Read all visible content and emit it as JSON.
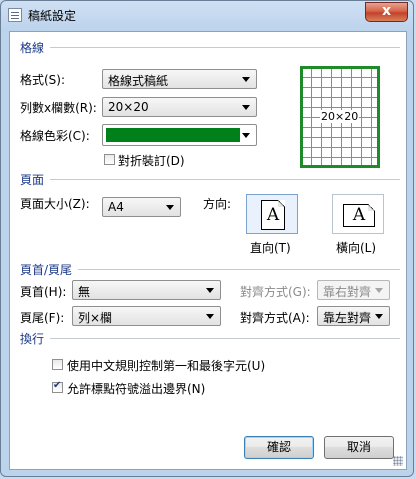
{
  "window": {
    "title": "稿紙設定",
    "close_glyph": "x"
  },
  "sections": {
    "grid": "格線",
    "page": "頁面",
    "header_footer": "頁首/頁尾",
    "line_wrap": "換行"
  },
  "grid": {
    "style_label": "格式(S):",
    "style_value": "格線式稿紙",
    "size_label": "列數x欄數(R):",
    "size_value": "20×20",
    "color_label": "格線色彩(C):",
    "color_value": "#00801b",
    "fold_label": "對折裝訂(D)",
    "fold_checked": false,
    "preview_text": "20×20"
  },
  "page": {
    "size_label": "頁面大小(Z):",
    "size_value": "A4",
    "orientation_label": "方向:",
    "portrait_label": "直向(T)",
    "landscape_label": "橫向(L)",
    "page_glyph": "A"
  },
  "header_footer": {
    "header_label": "頁首(H):",
    "header_value": "無",
    "header_align_label": "對齊方式(G):",
    "header_align_value": "靠右對齊",
    "footer_label": "頁尾(F):",
    "footer_value": "列×欄",
    "footer_align_label": "對齊方式(A):",
    "footer_align_value": "靠左對齊"
  },
  "line_wrap": {
    "rule_label": "使用中文規則控制第一和最後字元(U)",
    "rule_checked": false,
    "punct_label": "允許標點符號溢出邊界(N)",
    "punct_checked": true
  },
  "buttons": {
    "ok": "確認",
    "cancel": "取消"
  }
}
